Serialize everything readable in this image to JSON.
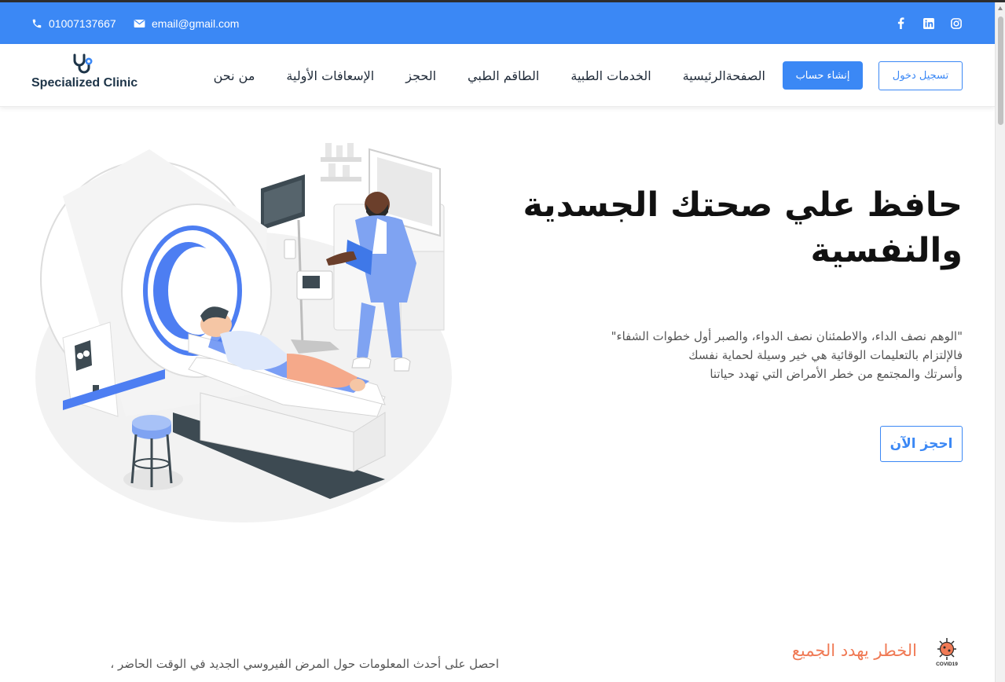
{
  "topbar": {
    "phone": "01007137667",
    "email": "email@gmail.com",
    "social_icons": [
      "facebook-icon",
      "linkedin-icon",
      "instagram-icon"
    ],
    "background": "#3b88f5"
  },
  "navbar": {
    "logo_text": "Specialized Clinic",
    "links": [
      "الصفحةالرئيسية",
      "الخدمات الطبية",
      "الطاقم الطبي",
      "الحجز",
      "الإسعافات الأولية",
      "من نحن"
    ],
    "register_label": "إنشاء حساب",
    "login_label": "تسجيل دخول"
  },
  "hero": {
    "title_line1": "حافظ علي صحتك الجسدية",
    "title_line2": "والنفسية",
    "desc_line1": "\"الوهم نصف الداء، والاطمئنان نصف الدواء، والصبر أول خطوات الشفاء\"",
    "desc_line2": "فالإلتزام بالتعليمات الوقائية هي خير وسيلة لحماية نفسك",
    "desc_line3": "وأسرتك والمجتمع من خطر الأمراض التي تهدد حياتنا",
    "book_label": "احجز الآن"
  },
  "covid": {
    "title": "الخطر يهدد الجميع",
    "icon_label": "COVID19",
    "desc": "احصل على أحدث المعلومات حول المرض الفيروسي الجديد في الوقت الحاضر ،",
    "title_color": "#f07a55"
  },
  "colors": {
    "accent": "#3b88f5",
    "logo_dark": "#1d3448"
  }
}
